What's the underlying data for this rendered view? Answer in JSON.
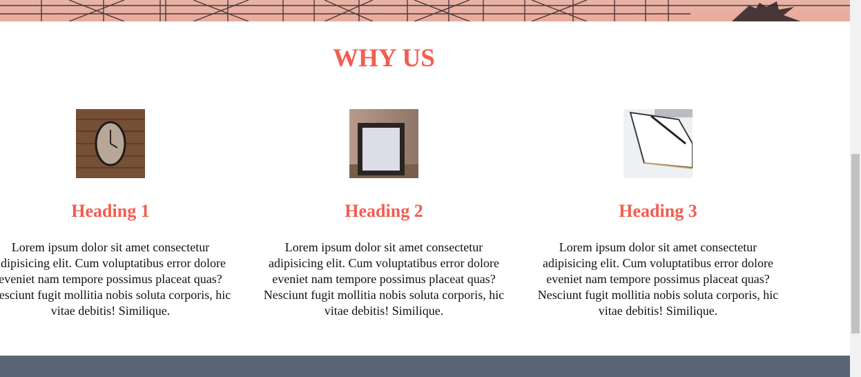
{
  "why_us": {
    "title": "WHY US"
  },
  "features": [
    {
      "heading": "Heading 1",
      "image": "wall-clock-photo",
      "text": "Lorem ipsum dolor sit amet consectetur adipisicing elit. Cum voluptatibus error dolore eveniet nam tempore possimus placeat quas? Nesciunt fugit mollitia nobis soluta corporis, hic vitae debitis! Similique."
    },
    {
      "heading": "Heading 2",
      "image": "picture-frame-photo",
      "text": "Lorem ipsum dolor sit amet consectetur adipisicing elit. Cum voluptatibus error dolore eveniet nam tempore possimus placeat quas? Nesciunt fugit mollitia nobis soluta corporis, hic vitae debitis! Similique."
    },
    {
      "heading": "Heading 3",
      "image": "notebook-pen-photo",
      "text": "Lorem ipsum dolor sit amet consectetur adipisicing elit. Cum voluptatibus error dolore eveniet nam tempore possimus placeat quas? Nesciunt fugit mollitia nobis soluta corporis, hic vitae debitis! Similique."
    }
  ],
  "colors": {
    "accent": "#f25d50",
    "footer": "#596474",
    "hero_tint": "#e9aa9c"
  }
}
